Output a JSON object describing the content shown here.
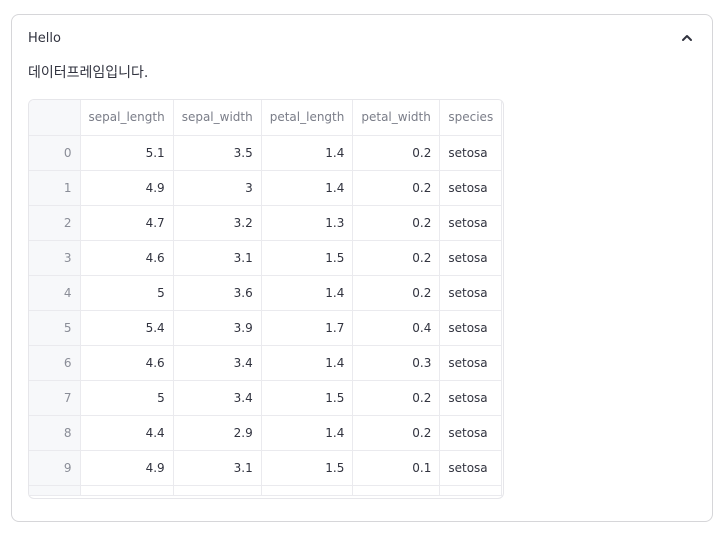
{
  "expander": {
    "title": "Hello",
    "expanded": true
  },
  "message": "데이터프레임입니다.",
  "dataframe": {
    "columns": [
      "sepal_length",
      "sepal_width",
      "petal_length",
      "petal_width",
      "species"
    ],
    "rows": [
      {
        "index": "0",
        "sepal_length": "5.1",
        "sepal_width": "3.5",
        "petal_length": "1.4",
        "petal_width": "0.2",
        "species": "setosa"
      },
      {
        "index": "1",
        "sepal_length": "4.9",
        "sepal_width": "3",
        "petal_length": "1.4",
        "petal_width": "0.2",
        "species": "setosa"
      },
      {
        "index": "2",
        "sepal_length": "4.7",
        "sepal_width": "3.2",
        "petal_length": "1.3",
        "petal_width": "0.2",
        "species": "setosa"
      },
      {
        "index": "3",
        "sepal_length": "4.6",
        "sepal_width": "3.1",
        "petal_length": "1.5",
        "petal_width": "0.2",
        "species": "setosa"
      },
      {
        "index": "4",
        "sepal_length": "5",
        "sepal_width": "3.6",
        "petal_length": "1.4",
        "petal_width": "0.2",
        "species": "setosa"
      },
      {
        "index": "5",
        "sepal_length": "5.4",
        "sepal_width": "3.9",
        "petal_length": "1.7",
        "petal_width": "0.4",
        "species": "setosa"
      },
      {
        "index": "6",
        "sepal_length": "4.6",
        "sepal_width": "3.4",
        "petal_length": "1.4",
        "petal_width": "0.3",
        "species": "setosa"
      },
      {
        "index": "7",
        "sepal_length": "5",
        "sepal_width": "3.4",
        "petal_length": "1.5",
        "petal_width": "0.2",
        "species": "setosa"
      },
      {
        "index": "8",
        "sepal_length": "4.4",
        "sepal_width": "2.9",
        "petal_length": "1.4",
        "petal_width": "0.2",
        "species": "setosa"
      },
      {
        "index": "9",
        "sepal_length": "4.9",
        "sepal_width": "3.1",
        "petal_length": "1.5",
        "petal_width": "0.1",
        "species": "setosa"
      }
    ]
  },
  "icons": {
    "collapse": "chevron-up-icon"
  },
  "colors": {
    "border": "#d6d6d9",
    "text": "#31333f",
    "header_text": "#7a7d88",
    "index_bg": "#f7f8fa"
  }
}
